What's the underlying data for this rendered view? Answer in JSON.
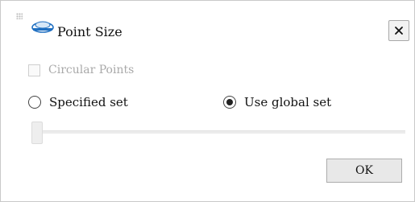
{
  "window": {
    "title": "Point Size",
    "logo_icon": "app-logo-icon",
    "close_icon": "close-icon"
  },
  "options": {
    "circular_points": {
      "label": "Circular Points",
      "checked": false,
      "enabled": false
    },
    "specified_set": {
      "label": "Specified set",
      "selected": false
    },
    "use_global_set": {
      "label": "Use global set",
      "selected": true
    }
  },
  "slider": {
    "value": 0,
    "enabled": false
  },
  "footer": {
    "ok_label": "OK"
  },
  "colors": {
    "logo_blue": "#1f6fc1",
    "disabled_text": "#a9a9a9"
  }
}
